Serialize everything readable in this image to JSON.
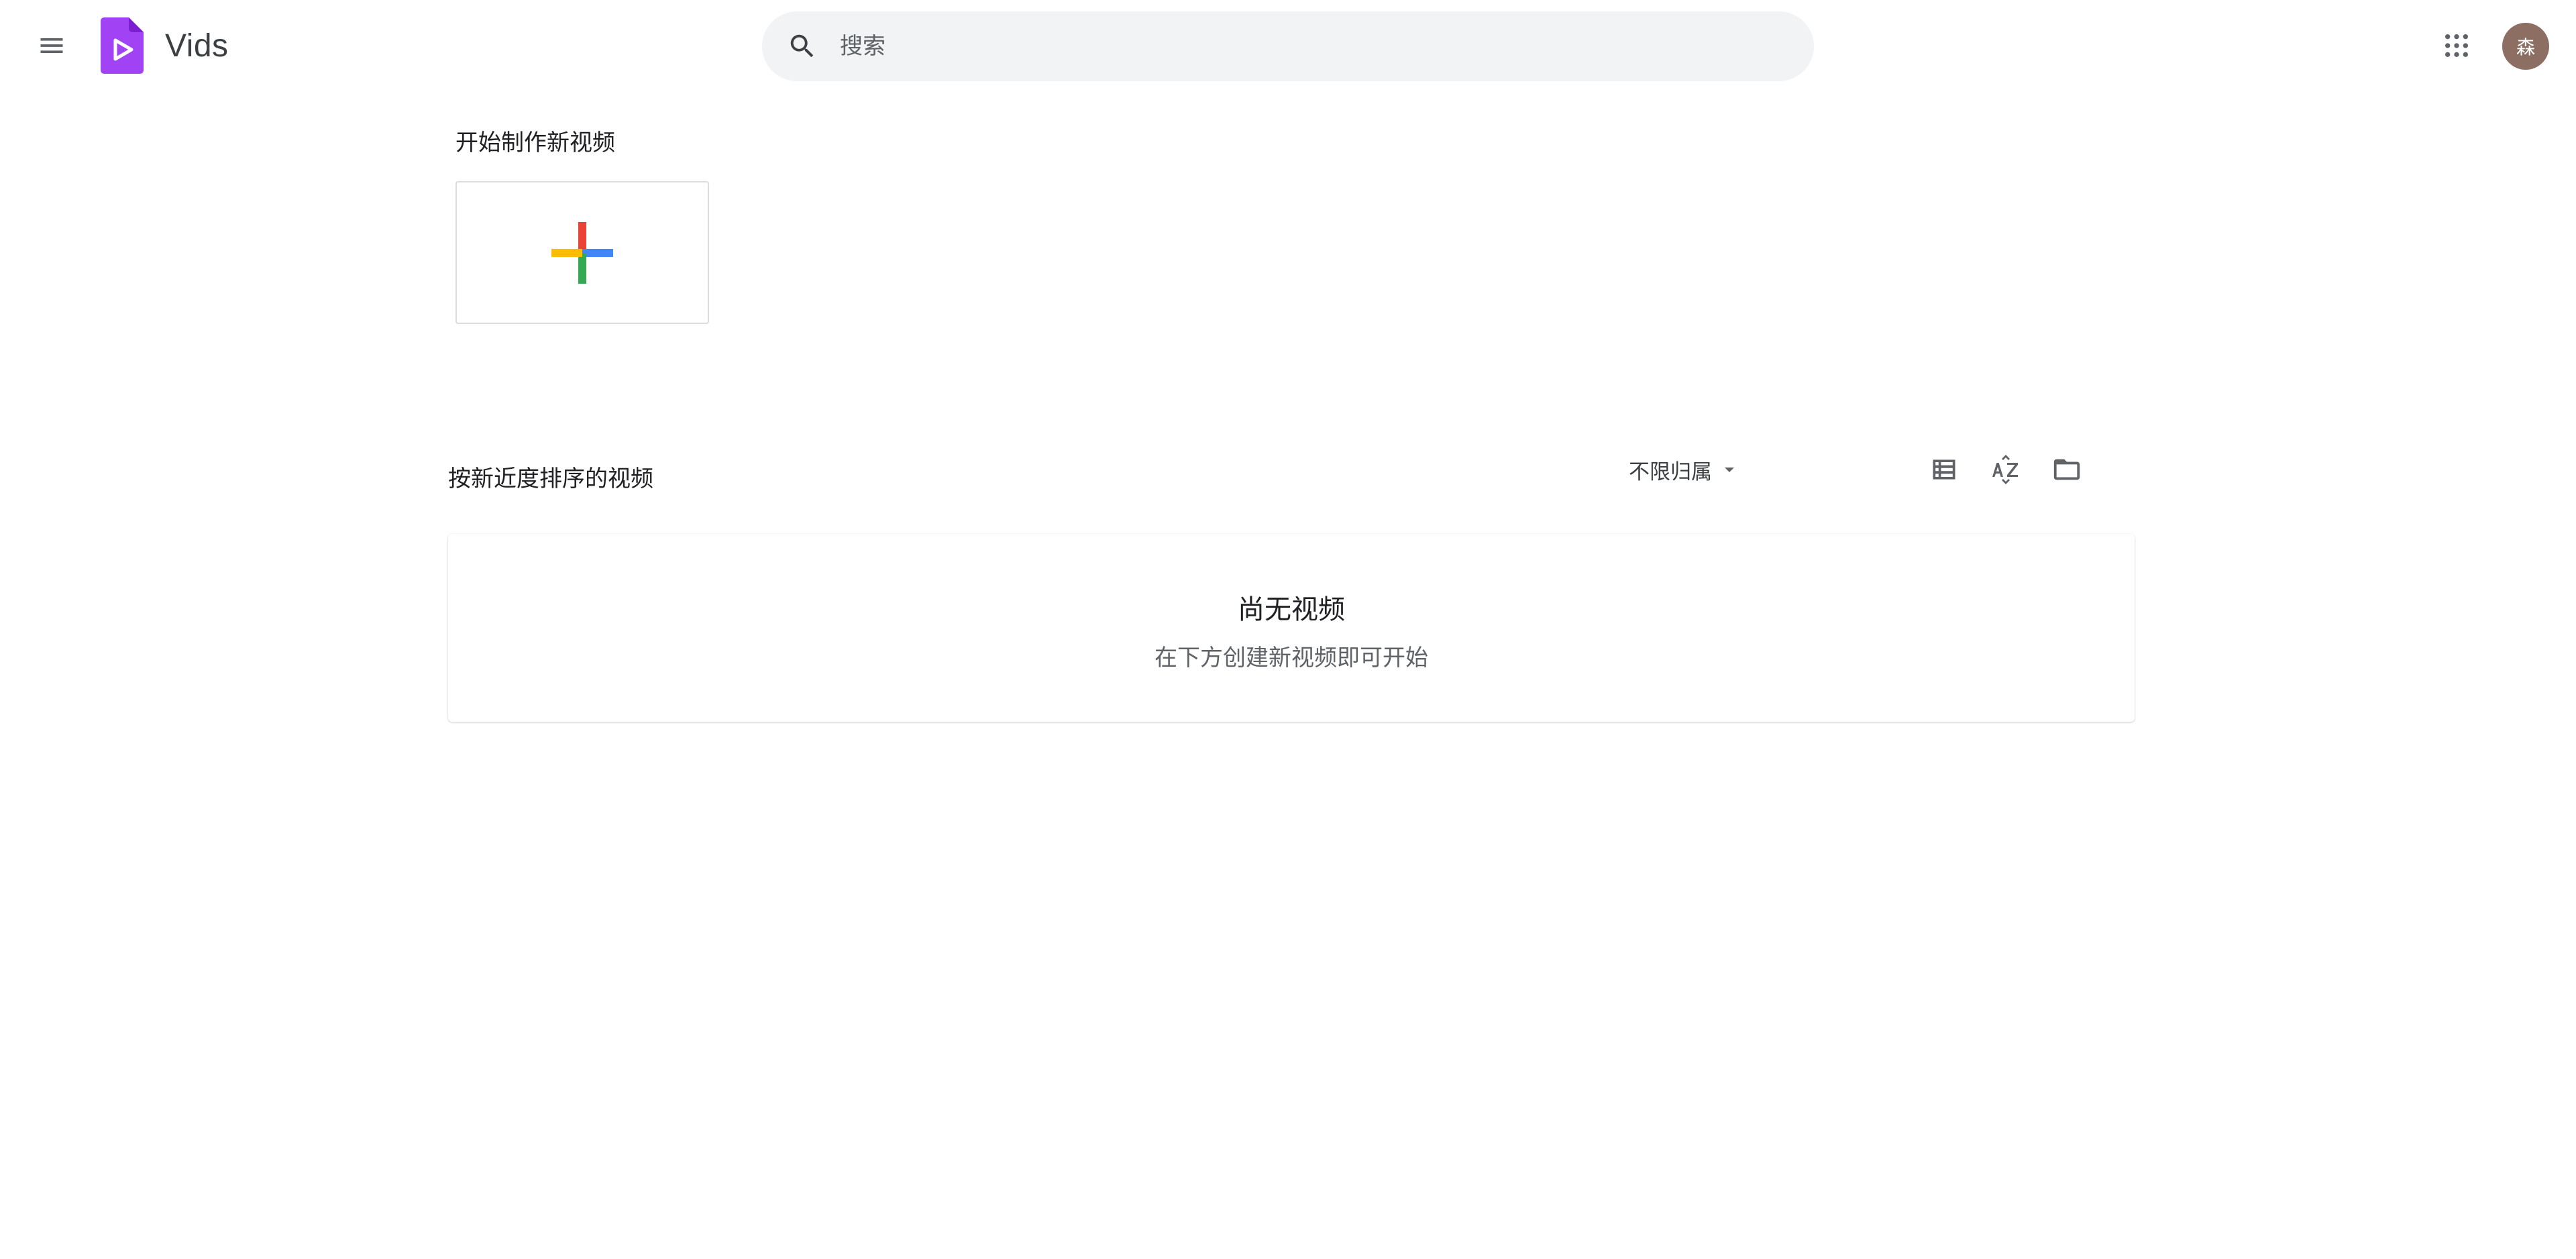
{
  "header": {
    "app_title": "Vids",
    "search": {
      "placeholder": "搜索",
      "value": ""
    },
    "account": {
      "avatar_initial": "森",
      "avatar_color": "#8d6e63"
    },
    "icons": [
      "menu-icon",
      "vids-logo-icon",
      "search-icon",
      "google-apps-icon"
    ]
  },
  "start_section": {
    "title": "开始制作新视频",
    "new_card_icon": "multicolor-plus-icon",
    "plus_colors": {
      "red": "#ea4335",
      "blue": "#4285f4",
      "green": "#34a853",
      "yellow": "#fbbc04"
    }
  },
  "recent_section": {
    "title": "按新近度排序的视频",
    "owner_filter": {
      "selected": "不限归属"
    },
    "tools": [
      "list-view-icon",
      "sort-az-icon",
      "folder-icon"
    ],
    "empty_state": {
      "title": "尚无视频",
      "subtitle": "在下方创建新视频即可开始"
    }
  },
  "colors": {
    "brand_purple": "#a142f4",
    "text_primary": "#202124",
    "text_secondary": "#5f6368"
  }
}
